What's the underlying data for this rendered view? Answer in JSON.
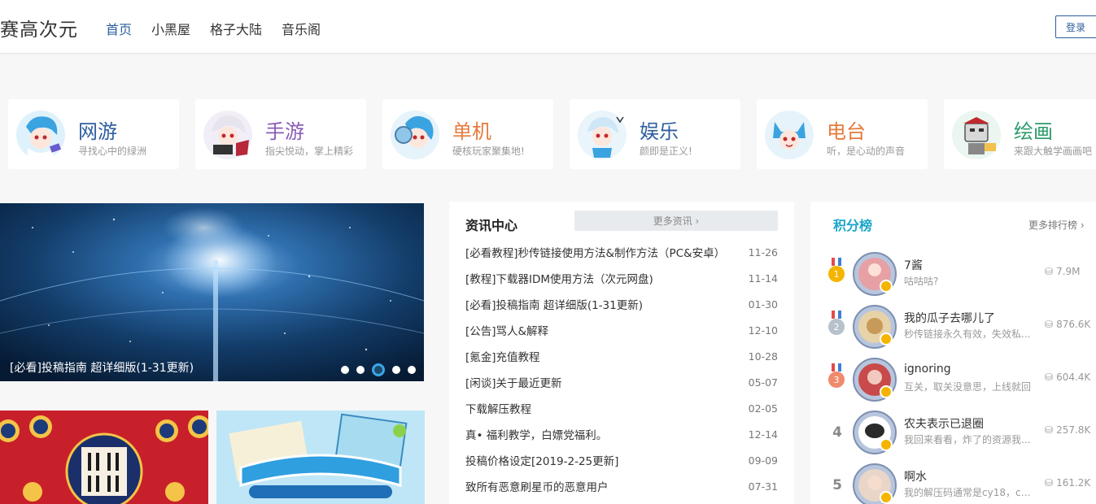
{
  "header": {
    "logo": "赛高次元",
    "nav": [
      "首页",
      "小黑屋",
      "格子大陆",
      "音乐阁"
    ],
    "login": "登录"
  },
  "categories": [
    {
      "title": "网游",
      "desc": "寻找心中的绿洲",
      "color": "#2e5e9e"
    },
    {
      "title": "手游",
      "desc": "指尖悦动，掌上精彩",
      "color": "#8a5cb8"
    },
    {
      "title": "单机",
      "desc": "硬核玩家聚集地!",
      "color": "#e57a3c"
    },
    {
      "title": "娱乐",
      "desc": "颜即是正义!",
      "color": "#2e5e9e"
    },
    {
      "title": "电台",
      "desc": "听，是心动的声音",
      "color": "#e57a3c"
    },
    {
      "title": "绘画",
      "desc": "来跟大触学画画吧",
      "color": "#2a9a6a"
    }
  ],
  "banner": {
    "caption": "[必看]投稿指南 超详细版(1-31更新)",
    "slides": 5,
    "active_slide": 3
  },
  "news": {
    "title": "资讯中心",
    "more": "更多资讯 ›",
    "items": [
      {
        "title": "[必看教程]秒传链接使用方法&制作方法（PC&安卓）",
        "date": "11-26"
      },
      {
        "title": "[教程]下载器IDM使用方法（次元网盘)",
        "date": "11-14"
      },
      {
        "title": "[必看]投稿指南 超详细版(1-31更新)",
        "date": "01-30"
      },
      {
        "title": "[公告]骂人&解释",
        "date": "12-10"
      },
      {
        "title": "[氪金]充值教程",
        "date": "10-28"
      },
      {
        "title": "[闲谈]关于最近更新",
        "date": "05-07"
      },
      {
        "title": "下载解压教程",
        "date": "02-05"
      },
      {
        "title": "真• 福利教学，白嫖党福利。",
        "date": "12-14"
      },
      {
        "title": "投稿价格设定[2019-2-25更新]",
        "date": "09-09"
      },
      {
        "title": "致所有恶意刷星币的恶意用户",
        "date": "07-31"
      }
    ]
  },
  "ranking": {
    "title": "积分榜",
    "more": "更多排行榜 ›",
    "items": [
      {
        "rank": "1",
        "name": "7酱",
        "sign": "咕咕咕?",
        "coins": "7.9M"
      },
      {
        "rank": "2",
        "name": "我的瓜子去哪儿了",
        "sign": "秒传链接永久有效，失效私...",
        "coins": "876.6K"
      },
      {
        "rank": "3",
        "name": "ignoring",
        "sign": "互关，取关没意思，上线就回",
        "coins": "604.4K"
      },
      {
        "rank": "4",
        "name": "农夫表示已退圈",
        "sign": "我回来看看，炸了的资源我...",
        "coins": "257.8K"
      },
      {
        "rank": "5",
        "name": "啊水",
        "sign": "我的解压码通常是cy18，cy1...",
        "coins": "161.2K"
      }
    ]
  },
  "colors": {
    "accent": "#2e5e9e",
    "rank_title": "#1aa6c8"
  }
}
